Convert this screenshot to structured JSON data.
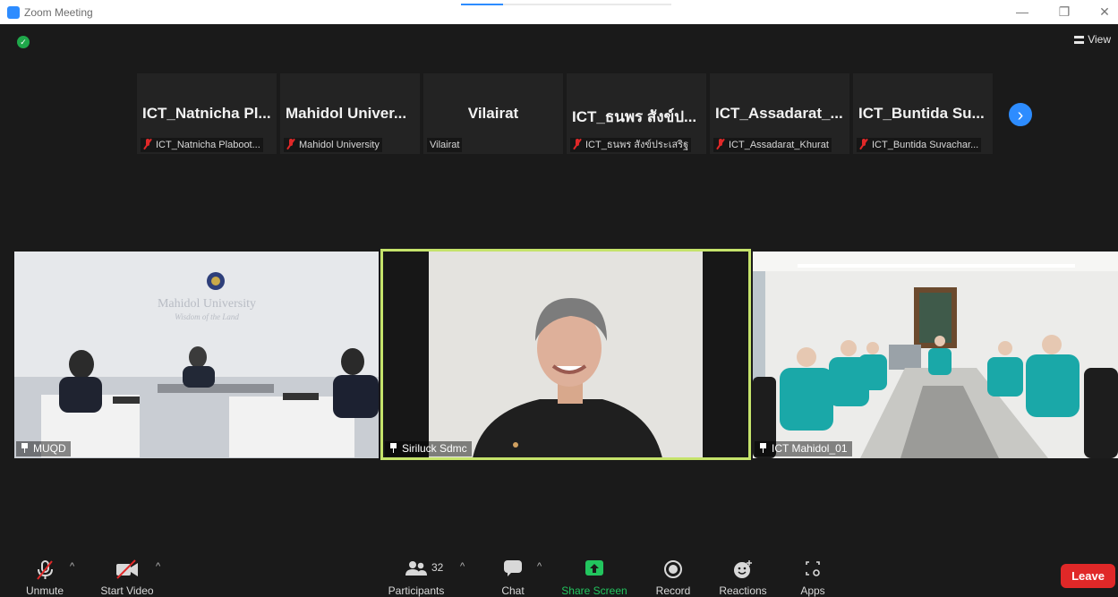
{
  "window": {
    "title": "Zoom Meeting"
  },
  "header": {
    "view_label": "View"
  },
  "strip": {
    "thumbnails": [
      {
        "display": "ICT_Natnicha Pl...",
        "name": "ICT_Natnicha Plaboot...",
        "muted": true
      },
      {
        "display": "Mahidol Univer...",
        "name": "Mahidol University",
        "muted": true
      },
      {
        "display": "Vilairat",
        "name": "Vilairat",
        "muted": false
      },
      {
        "display": "ICT_ธนพร สังข์ป...",
        "name": "ICT_ธนพร สังข์ประเสริฐ",
        "muted": true
      },
      {
        "display": "ICT_Assadarat_...",
        "name": "ICT_Assadarat_Khurat",
        "muted": true
      },
      {
        "display": "ICT_Buntida Su...",
        "name": "ICT_Buntida Suvachar...",
        "muted": true
      }
    ]
  },
  "tiles": [
    {
      "name": "MUQD",
      "sign_title": "Mahidol University",
      "sign_sub": "Wisdom of the Land"
    },
    {
      "name": "Siriluck Sdmc"
    },
    {
      "name": "ICT Mahidol_01"
    }
  ],
  "toolbar": {
    "unmute": "Unmute",
    "start_video": "Start Video",
    "participants": "Participants",
    "participants_count": "32",
    "chat": "Chat",
    "share_screen": "Share Screen",
    "record": "Record",
    "reactions": "Reactions",
    "apps": "Apps",
    "leave": "Leave"
  },
  "colors": {
    "accent": "#2d8cff",
    "share_green": "#22c55e",
    "leave_red": "#e02828",
    "active_speaker_border": "#c5e36b",
    "mute_red": "#e02828"
  }
}
